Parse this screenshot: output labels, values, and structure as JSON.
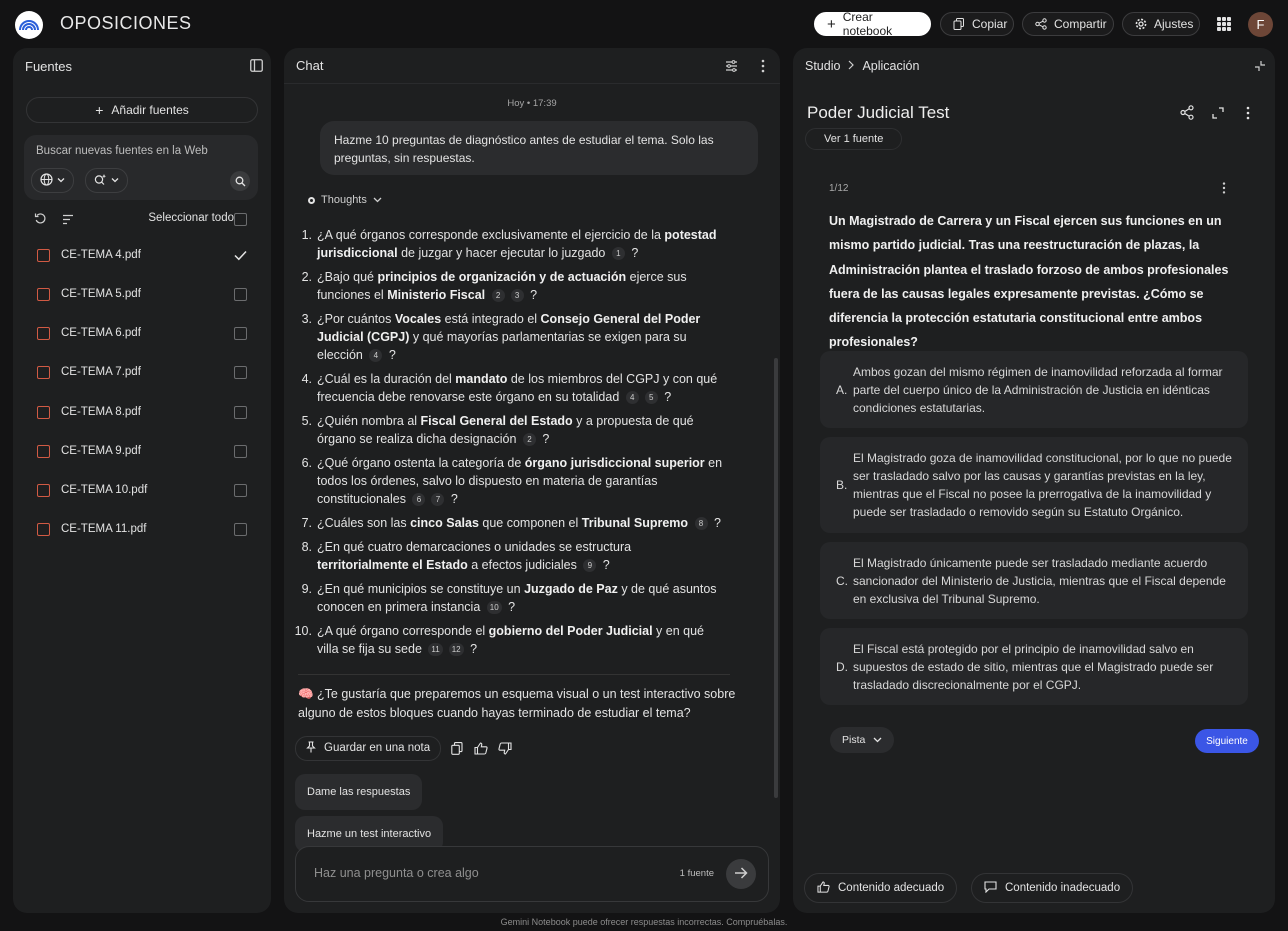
{
  "app": {
    "title": "OPOSICIONES",
    "avatar_letter": "F"
  },
  "topbar": {
    "create_label": "Crear notebook",
    "copy_label": "Copiar",
    "share_label": "Compartir",
    "settings_label": "Ajustes"
  },
  "sources": {
    "title": "Fuentes",
    "add_label": "Añadir fuentes",
    "search_placeholder": "Buscar nuevas fuentes en la Web",
    "select_all_label": "Seleccionar todo",
    "files": [
      {
        "name": "CE-TEMA 4.pdf",
        "checked": true
      },
      {
        "name": "CE-TEMA 5.pdf",
        "checked": false
      },
      {
        "name": "CE-TEMA 6.pdf",
        "checked": false
      },
      {
        "name": "CE-TEMA 7.pdf",
        "checked": false
      },
      {
        "name": "CE-TEMA 8.pdf",
        "checked": false
      },
      {
        "name": "CE-TEMA 9.pdf",
        "checked": false
      },
      {
        "name": "CE-TEMA 10.pdf",
        "checked": false
      },
      {
        "name": "CE-TEMA 11.pdf",
        "checked": false
      }
    ]
  },
  "chat": {
    "title": "Chat",
    "timestamp": "Hoy • 17:39",
    "user_message": "Hazme 10 preguntas de diagnóstico antes de estudiar el tema. Solo las preguntas, sin respuestas.",
    "thoughts_label": "Thoughts",
    "questions": [
      [
        [
          "¿A qué órganos corresponde exclusivamente el ejercicio de la ",
          0
        ],
        [
          "potestad jurisdiccional",
          1
        ],
        [
          " de juzgar y hacer ejecutar lo juzgado ",
          0
        ],
        [
          "1",
          2
        ],
        [
          " ?",
          0
        ]
      ],
      [
        [
          "¿Bajo qué ",
          0
        ],
        [
          "principios de organización y de actuación",
          1
        ],
        [
          " ejerce sus funciones el ",
          0
        ],
        [
          "Ministerio Fiscal",
          1
        ],
        [
          " ",
          0
        ],
        [
          "2",
          2
        ],
        [
          "3",
          2
        ],
        [
          " ?",
          0
        ]
      ],
      [
        [
          "¿Por cuántos ",
          0
        ],
        [
          "Vocales",
          1
        ],
        [
          " está integrado el ",
          0
        ],
        [
          "Consejo General del Poder Judicial (CGPJ)",
          1
        ],
        [
          " y qué mayorías parlamentarias se exigen para su elección ",
          0
        ],
        [
          "4",
          2
        ],
        [
          " ?",
          0
        ]
      ],
      [
        [
          "¿Cuál es la duración del ",
          0
        ],
        [
          "mandato",
          1
        ],
        [
          " de los miembros del CGPJ y con qué frecuencia debe renovarse este órgano en su totalidad ",
          0
        ],
        [
          "4",
          2
        ],
        [
          "5",
          2
        ],
        [
          " ?",
          0
        ]
      ],
      [
        [
          "¿Quién nombra al ",
          0
        ],
        [
          "Fiscal General del Estado",
          1
        ],
        [
          " y a propuesta de qué órgano se realiza dicha designación ",
          0
        ],
        [
          "2",
          2
        ],
        [
          " ?",
          0
        ]
      ],
      [
        [
          "¿Qué órgano ostenta la categoría de ",
          0
        ],
        [
          "órgano jurisdiccional superior",
          1
        ],
        [
          " en todos los órdenes, salvo lo dispuesto en materia de garantías constitucionales ",
          0
        ],
        [
          "6",
          2
        ],
        [
          "7",
          2
        ],
        [
          " ?",
          0
        ]
      ],
      [
        [
          "¿Cuáles son las ",
          0
        ],
        [
          "cinco Salas",
          1
        ],
        [
          " que componen el ",
          0
        ],
        [
          "Tribunal Supremo",
          1
        ],
        [
          " ",
          0
        ],
        [
          "8",
          2
        ],
        [
          " ?",
          0
        ]
      ],
      [
        [
          "¿En qué cuatro demarcaciones o unidades se estructura ",
          0
        ],
        [
          "territorialmente el Estado",
          1
        ],
        [
          " a efectos judiciales ",
          0
        ],
        [
          "9",
          2
        ],
        [
          " ?",
          0
        ]
      ],
      [
        [
          "¿En qué municipios se constituye un ",
          0
        ],
        [
          "Juzgado de Paz",
          1
        ],
        [
          " y de qué asuntos conocen en primera instancia ",
          0
        ],
        [
          "10",
          2
        ],
        [
          " ?",
          0
        ]
      ],
      [
        [
          "¿A qué órgano corresponde el ",
          0
        ],
        [
          "gobierno del Poder Judicial",
          1
        ],
        [
          " y en qué villa se fija su sede ",
          0
        ],
        [
          "11",
          2
        ],
        [
          "12",
          2
        ],
        [
          " ?",
          0
        ]
      ]
    ],
    "followup": "🧠 ¿Te gustaría que preparemos un esquema visual o un test interactivo sobre alguno de estos bloques cuando hayas terminado de estudiar el tema?",
    "save_note_label": "Guardar en una nota",
    "suggestions": [
      "Dame las respuestas",
      "Hazme un test interactivo"
    ],
    "input_placeholder": "Haz una pregunta o crea algo",
    "source_count": "1 fuente"
  },
  "studio": {
    "crumb_root": "Studio",
    "crumb_current": "Aplicación",
    "title": "Poder Judicial Test",
    "source_chip": "Ver 1 fuente",
    "counter": "1/12",
    "question": "Un Magistrado de Carrera y un Fiscal ejercen sus funciones en un mismo partido judicial. Tras una reestructuración de plazas, la Administración plantea el traslado forzoso de ambos profesionales fuera de las causas legales expresamente previstas. ¿Cómo se diferencia la protección estatutaria constitucional entre ambos profesionales?",
    "options": [
      {
        "letter": "A.",
        "text": "Ambos gozan del mismo régimen de inamovilidad reforzada al formar parte del cuerpo único de la Administración de Justicia en idénticas condiciones estatutarias."
      },
      {
        "letter": "B.",
        "text": "El Magistrado goza de inamovilidad constitucional, por lo que no puede ser trasladado salvo por las causas y garantías previstas en la ley, mientras que el Fiscal no posee la prerrogativa de la inamovilidad y puede ser trasladado o removido según su Estatuto Orgánico."
      },
      {
        "letter": "C.",
        "text": "El Magistrado únicamente puede ser trasladado mediante acuerdo sancionador del Ministerio de Justicia, mientras que el Fiscal depende en exclusiva del Tribunal Supremo."
      },
      {
        "letter": "D.",
        "text": "El Fiscal está protegido por el principio de inamovilidad salvo en supuestos de estado de sitio, mientras que el Magistrado puede ser trasladado discrecionalmente por el CGPJ."
      }
    ],
    "hint_label": "Pista",
    "next_label": "Siguiente",
    "good_label": "Contenido adecuado",
    "bad_label": "Contenido inadecuado"
  },
  "footer": "Gemini Notebook puede ofrecer respuestas incorrectas. Compruébalas."
}
